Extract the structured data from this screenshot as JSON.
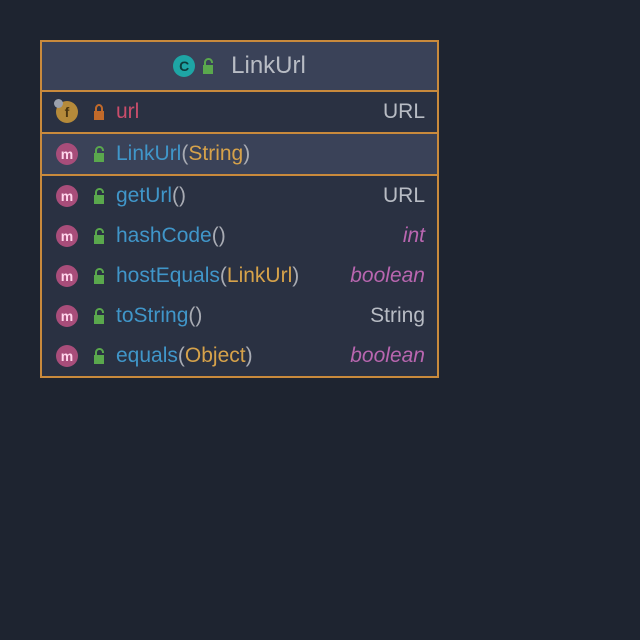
{
  "class": {
    "name": "LinkUrl",
    "icon": "class-icon",
    "iconLetter": "C",
    "visibility": "public"
  },
  "fields": [
    {
      "icon": "field-icon",
      "iconLetter": "f",
      "visibility": "private",
      "name": "url",
      "type": "URL",
      "typeKind": "ref"
    }
  ],
  "constructors": [
    {
      "icon": "method-icon",
      "iconLetter": "m",
      "visibility": "public",
      "name": "LinkUrl",
      "params": "String",
      "type": "",
      "typeKind": "",
      "selected": true
    }
  ],
  "methods": [
    {
      "icon": "method-icon",
      "iconLetter": "m",
      "visibility": "public",
      "name": "getUrl",
      "params": "",
      "type": "URL",
      "typeKind": "ref"
    },
    {
      "icon": "method-icon",
      "iconLetter": "m",
      "visibility": "public",
      "name": "hashCode",
      "params": "",
      "type": "int",
      "typeKind": "prim"
    },
    {
      "icon": "method-icon",
      "iconLetter": "m",
      "visibility": "public",
      "name": "hostEquals",
      "params": "LinkUrl",
      "type": "boolean",
      "typeKind": "prim"
    },
    {
      "icon": "method-icon",
      "iconLetter": "m",
      "visibility": "public",
      "name": "toString",
      "params": "",
      "type": "String",
      "typeKind": "ref"
    },
    {
      "icon": "method-icon",
      "iconLetter": "m",
      "visibility": "public",
      "name": "equals",
      "params": "Object",
      "type": "boolean",
      "typeKind": "prim"
    }
  ],
  "lp": "(",
  "rp": ")"
}
